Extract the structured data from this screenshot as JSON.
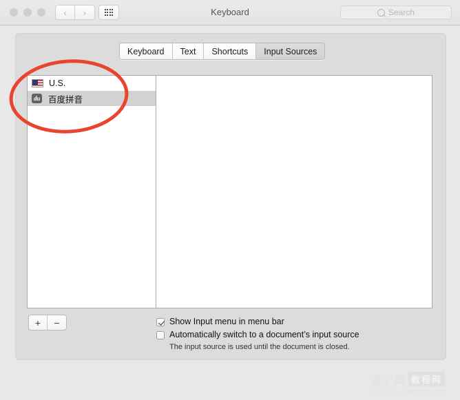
{
  "window": {
    "title": "Keyboard",
    "traffic_lights": [
      "close",
      "minimize",
      "maximize"
    ],
    "nav": {
      "back": "‹",
      "forward": "›"
    },
    "show_all_label": "show-all-grid"
  },
  "search": {
    "placeholder": "Search",
    "value": "",
    "icon": "search-icon"
  },
  "tabs": [
    {
      "label": "Keyboard",
      "selected": false
    },
    {
      "label": "Text",
      "selected": false
    },
    {
      "label": "Shortcuts",
      "selected": false
    },
    {
      "label": "Input Sources",
      "selected": true
    }
  ],
  "input_sources": [
    {
      "label": "U.S.",
      "icon": "us-flag-icon",
      "selected": false
    },
    {
      "label": "百度拼音",
      "icon": "baidu-du-icon",
      "icon_text": "du",
      "selected": true
    }
  ],
  "list_buttons": {
    "add": "+",
    "remove": "−"
  },
  "options": [
    {
      "label": "Show Input menu in menu bar",
      "checked": true,
      "hint": ""
    },
    {
      "label": "Automatically switch to a document’s input source",
      "checked": false,
      "hint": "The input source is used until the document is closed."
    }
  ],
  "annotation": {
    "shape": "ellipse",
    "color": "#e8442f",
    "stroke_width": 5
  },
  "watermark": {
    "text_primary": "查字典",
    "text_boxed": "教程网",
    "url": "jiaocheng.chazidian.com"
  },
  "colors": {
    "titlebar": "#e7e7e7",
    "pane": "#dcdcdc",
    "selection": "#d2d2d2",
    "annotation": "#e8442f"
  }
}
